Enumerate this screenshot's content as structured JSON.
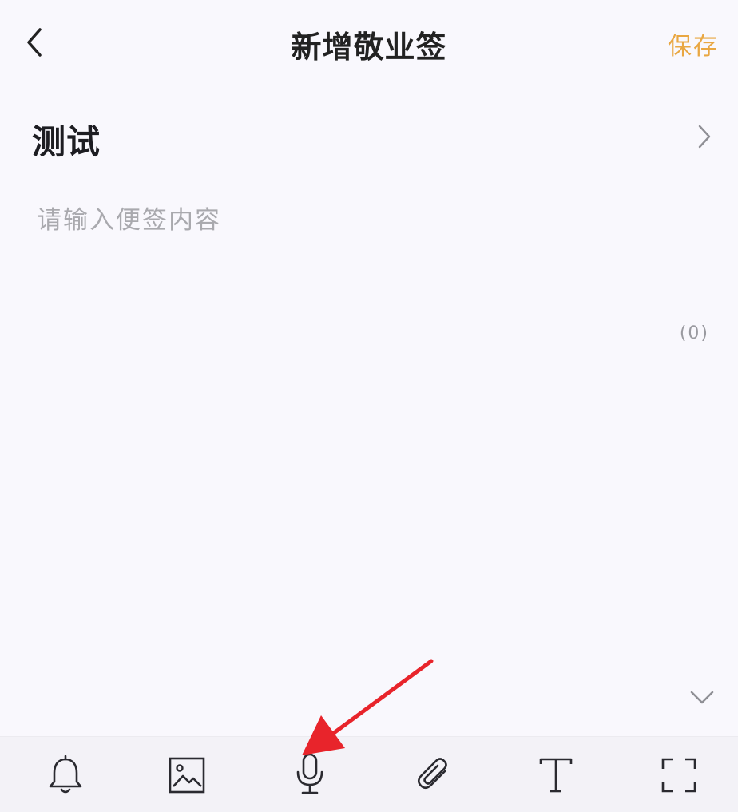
{
  "header": {
    "title": "新增敬业签",
    "save_label": "保存"
  },
  "note": {
    "title": "测试",
    "content_value": "",
    "content_placeholder": "请输入便签内容",
    "char_count": "(0)"
  },
  "toolbar": {
    "items": [
      {
        "icon": "bell-icon"
      },
      {
        "icon": "image-icon"
      },
      {
        "icon": "microphone-icon"
      },
      {
        "icon": "paperclip-icon"
      },
      {
        "icon": "text-format-icon"
      },
      {
        "icon": "fullscreen-icon"
      }
    ]
  },
  "colors": {
    "accent": "#e9a742",
    "background": "#f9f8fd",
    "toolbar_background": "#f3f2f7",
    "annotation_arrow": "#e8242b"
  }
}
